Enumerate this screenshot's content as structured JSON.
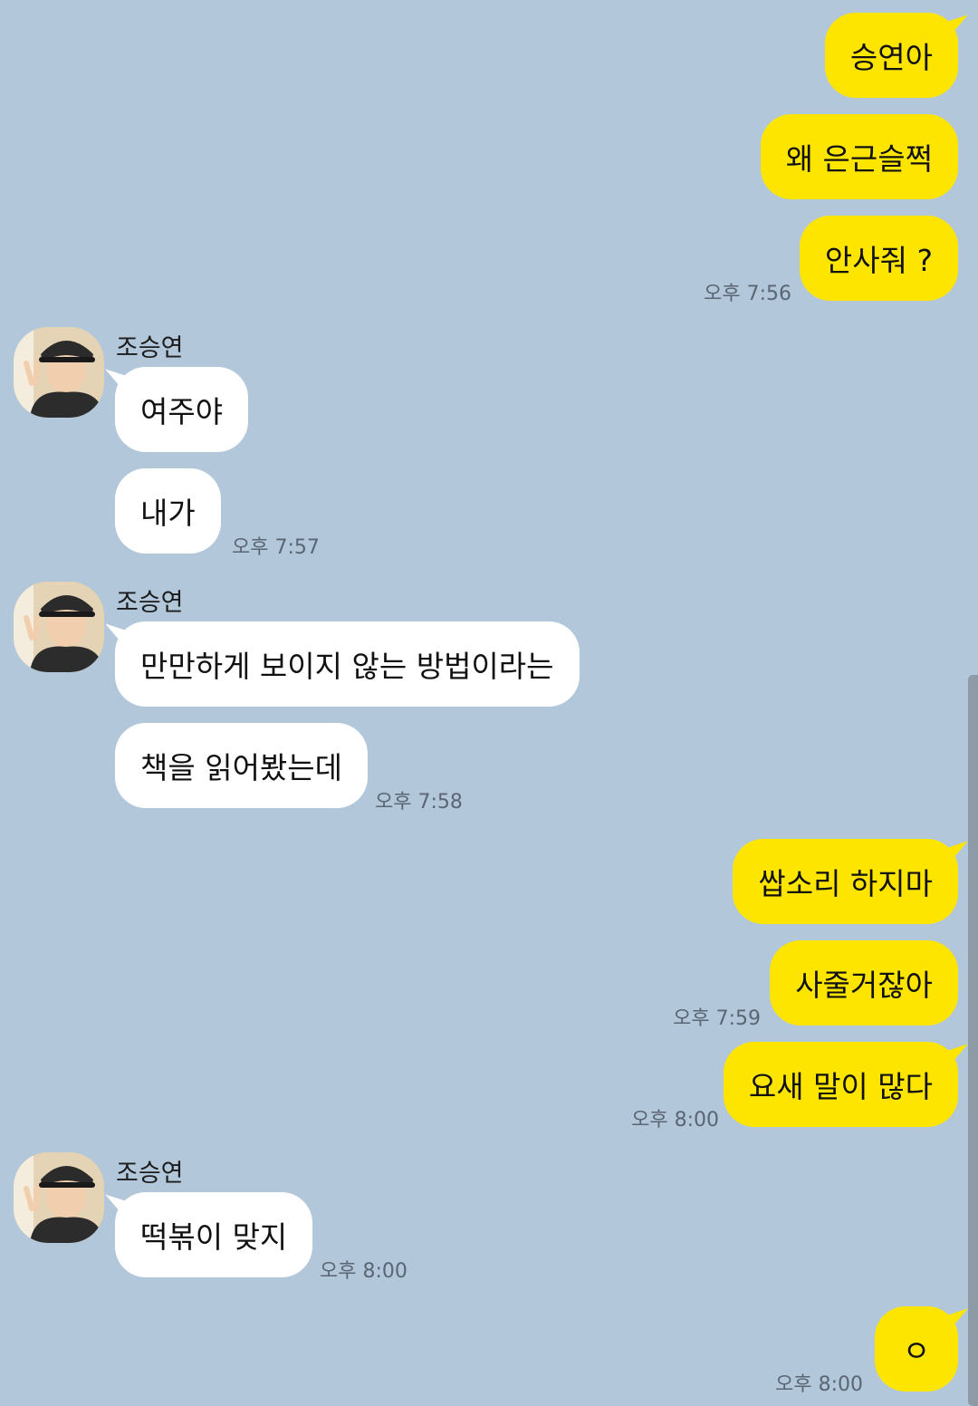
{
  "contact_name": "조승연",
  "avatar_icon": "profile-photo-icon",
  "colors": {
    "background": "#b2c7da",
    "my_bubble": "#fee500",
    "their_bubble": "#ffffff"
  },
  "messages": [
    {
      "sender": "me",
      "text": "승연아"
    },
    {
      "sender": "me",
      "text": "왜 은근슬쩍"
    },
    {
      "sender": "me",
      "text": "안사줘 ?",
      "time": "오후 7:56"
    },
    {
      "sender": "them",
      "name": "조승연",
      "text": "여주야"
    },
    {
      "sender": "them",
      "text": "내가",
      "time": "오후 7:57"
    },
    {
      "sender": "them",
      "name": "조승연",
      "text": "만만하게 보이지 않는 방법이라는"
    },
    {
      "sender": "them",
      "text": "책을 읽어봤는데",
      "time": "오후 7:58"
    },
    {
      "sender": "me",
      "text": "쌉소리 하지마"
    },
    {
      "sender": "me",
      "text": "사줄거잖아",
      "time": "오후 7:59"
    },
    {
      "sender": "me",
      "text": "요새 말이 많다",
      "time": "오후 8:00"
    },
    {
      "sender": "them",
      "name": "조승연",
      "text": "떡볶이 맞지",
      "time": "오후 8:00"
    },
    {
      "sender": "me",
      "text": "ㅇ",
      "time": "오후 8:00"
    }
  ]
}
